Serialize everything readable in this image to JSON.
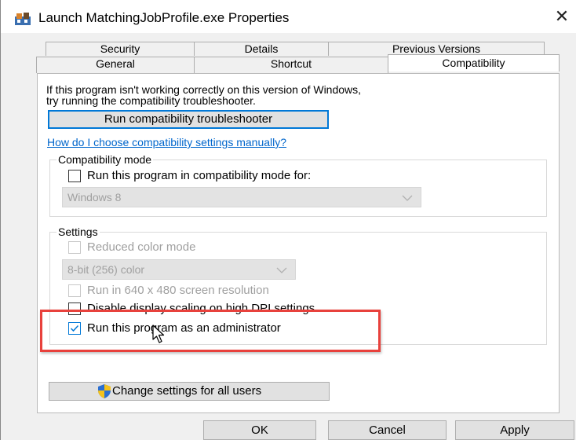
{
  "window": {
    "title": "Launch MatchingJobProfile.exe Properties",
    "close_glyph": "✕"
  },
  "tabs": {
    "row_back": [
      "Security",
      "Details",
      "Previous Versions"
    ],
    "row_front": [
      "General",
      "Shortcut",
      "Compatibility"
    ],
    "active": "Compatibility"
  },
  "compatibility": {
    "intro_line1": "If this program isn't working correctly on this version of Windows,",
    "intro_line2": "try running the compatibility troubleshooter.",
    "troubleshooter_button": "Run compatibility troubleshooter",
    "help_link": "How do I choose compatibility settings manually?",
    "mode_group": {
      "label": "Compatibility mode",
      "checkbox_label": "Run this program in compatibility mode for:",
      "checked": false,
      "os_select_value": "Windows 8"
    },
    "settings_group": {
      "label": "Settings",
      "reduced_color_label": "Reduced color mode",
      "color_select_value": "8-bit (256) color",
      "resolution_label": "Run in 640 x 480 screen resolution",
      "dpi_label": "Disable display scaling on high DPI settings",
      "dpi_checked": false,
      "admin_label": "Run this program as an administrator",
      "admin_checked": true
    },
    "all_users_button": "Change settings for all users"
  },
  "footer": {
    "ok": "OK",
    "cancel": "Cancel",
    "apply": "Apply"
  },
  "colors": {
    "accent": "#0078d7",
    "highlight": "#e8413c",
    "link": "#0066cc"
  }
}
